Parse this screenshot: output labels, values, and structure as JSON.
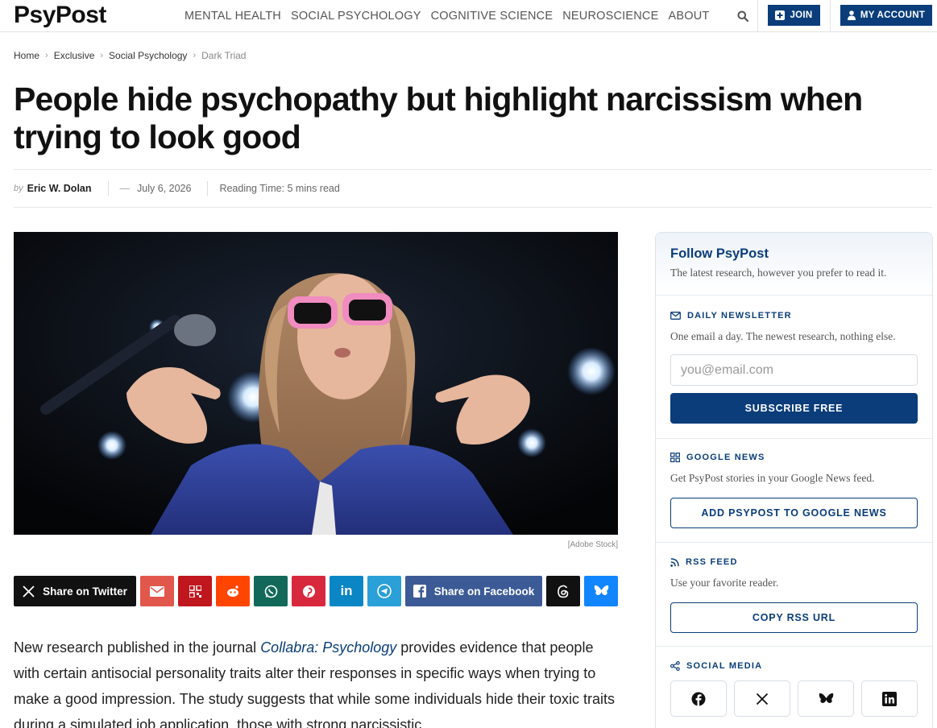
{
  "header": {
    "logo": "PsyPost",
    "nav": [
      "MENTAL HEALTH",
      "SOCIAL PSYCHOLOGY",
      "COGNITIVE SCIENCE",
      "NEUROSCIENCE",
      "ABOUT"
    ],
    "search_icon": "search-icon",
    "join_label": "JOIN",
    "account_label": "MY ACCOUNT",
    "accent_color": "#0a3d7a"
  },
  "breadcrumb": [
    "Home",
    "Exclusive",
    "Social Psychology",
    "Dark Triad"
  ],
  "article": {
    "title": "People hide psychopathy but highlight narcissism when trying to look good",
    "by": "by",
    "author": "Eric W. Dolan",
    "dash": "—",
    "date": "July 6, 2026",
    "reading_time": "Reading Time: 5 mins read",
    "image_caption": "[Adobe Stock]",
    "body_pre": "New research published in the journal ",
    "body_link": "Collabra: Psychology",
    "body_post": " provides evidence that people with certain antisocial personality traits alter their responses in specific ways when trying to make a good impression. The study suggests that while some individuals hide their toxic traits during a simulated job application, those with strong narcissistic"
  },
  "share": {
    "twitter": "Share on Twitter",
    "facebook": "Share on Facebook",
    "colors": {
      "twitter": "#111111",
      "email": "#e2574c",
      "qr": "#c0161d",
      "reddit": "#ff4500",
      "whatsapp": "#12695a",
      "pinterest": "#d8283d",
      "linkedin": "#0b86c5",
      "telegram": "#2a9fd8",
      "facebook": "#3c5b96",
      "threads": "#111111",
      "bluesky": "#1185fe"
    }
  },
  "sidebar": {
    "title": "Follow PsyPost",
    "subtitle": "The latest research, however you prefer to read it.",
    "newsletter": {
      "label": "DAILY NEWSLETTER",
      "desc": "One email a day. The newest research, nothing else.",
      "placeholder": "you@email.com",
      "button": "SUBSCRIBE FREE"
    },
    "google": {
      "label": "GOOGLE NEWS",
      "desc": "Get PsyPost stories in your Google News feed.",
      "button": "ADD PSYPOST TO GOOGLE NEWS"
    },
    "rss": {
      "label": "RSS FEED",
      "desc": "Use your favorite reader.",
      "button": "COPY RSS URL"
    },
    "social": {
      "label": "SOCIAL MEDIA",
      "icons": [
        "facebook-icon",
        "x-icon",
        "bluesky-icon",
        "linkedin-icon"
      ]
    }
  }
}
